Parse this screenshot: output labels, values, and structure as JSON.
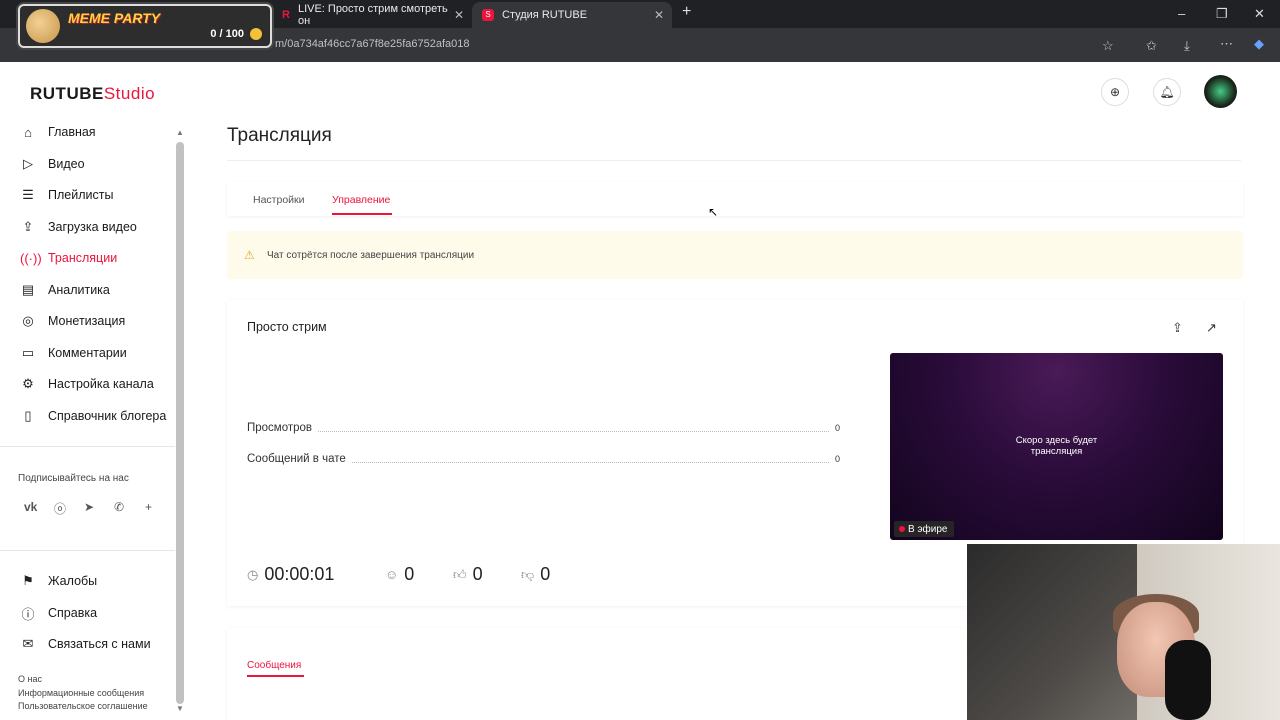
{
  "browser": {
    "tabs": [
      {
        "label": "LIVE: Просто стрим смотреть он"
      },
      {
        "label": "Студия RUTUBE"
      }
    ],
    "address": "m/0a734af46cc7a67f8e25fa6752afa018"
  },
  "overlay": {
    "title": "MEME PARTY",
    "count": "0 / 100"
  },
  "header": {
    "logo_main": "RUTUBE",
    "logo_studio": "Studio"
  },
  "sidebar": {
    "items": [
      {
        "label": "Главная",
        "icon": "home-icon"
      },
      {
        "label": "Видео",
        "icon": "video-icon"
      },
      {
        "label": "Плейлисты",
        "icon": "playlist-icon"
      },
      {
        "label": "Загрузка видео",
        "icon": "upload-icon"
      },
      {
        "label": "Трансляции",
        "icon": "broadcast-icon",
        "active": true
      },
      {
        "label": "Аналитика",
        "icon": "analytics-icon"
      },
      {
        "label": "Монетизация",
        "icon": "monetization-icon"
      },
      {
        "label": "Комментарии",
        "icon": "comments-icon"
      },
      {
        "label": "Настройка канала",
        "icon": "gear-icon"
      },
      {
        "label": "Справочник блогера",
        "icon": "book-icon"
      }
    ],
    "subscribe_label": "Подписывайтесь на нас",
    "bottom_items": [
      {
        "label": "Жалобы",
        "icon": "flag-icon"
      },
      {
        "label": "Справка",
        "icon": "help-icon"
      },
      {
        "label": "Связаться с нами",
        "icon": "mail-icon"
      }
    ],
    "footer_links": [
      "О нас",
      "Информационные сообщения",
      "Пользовательское соглашение"
    ]
  },
  "page": {
    "title": "Трансляция",
    "tabs": [
      {
        "label": "Настройки"
      },
      {
        "label": "Управление",
        "active": true
      }
    ],
    "warning": "Чат сотрётся после завершения трансляции"
  },
  "stream": {
    "title": "Просто стрим",
    "stats": [
      {
        "label": "Просмотров",
        "value": "0"
      },
      {
        "label": "Сообщений в чате",
        "value": "0"
      }
    ],
    "player_text_line1": "Скоро здесь будет",
    "player_text_line2": "трансляция",
    "live_badge": "В эфире",
    "duration": "00:00:01",
    "viewers": "0",
    "likes": "0",
    "dislikes": "0"
  },
  "messages": {
    "tab_label": "Сообщения"
  },
  "colors": {
    "accent": "#ed143b",
    "warning_bg": "#fffbea"
  }
}
